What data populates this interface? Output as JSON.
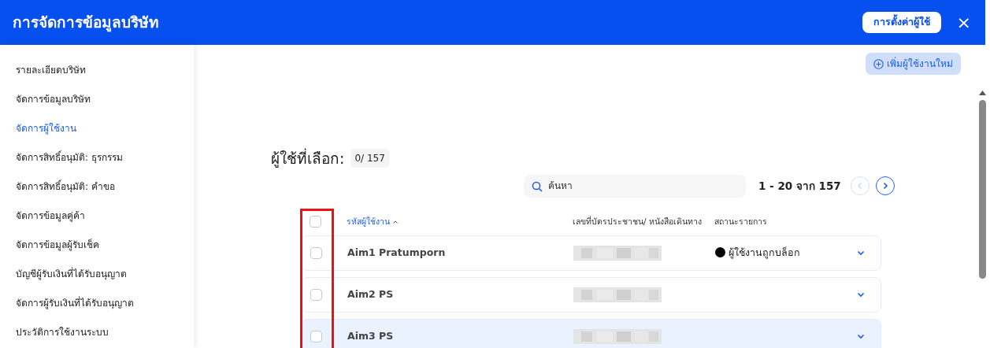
{
  "header": {
    "title": "การจัดการข้อมูลบริษัท",
    "settings_button": "การตั้งค่าผู้ใช้",
    "close": "×"
  },
  "sidebar": {
    "items": [
      {
        "label": "รายละเอียดบริษัท",
        "selected": false
      },
      {
        "label": "จัดการข้อมูลบริษัท",
        "selected": false
      },
      {
        "label": "จัดการผู้ใช้งาน",
        "selected": true
      },
      {
        "label": "จัดการสิทธิ์อนุมัติ: ธุรกรรม",
        "selected": false
      },
      {
        "label": "จัดการสิทธิ์อนุมัติ: คำขอ",
        "selected": false
      },
      {
        "label": "จัดการข้อมูลคู่ค้า",
        "selected": false
      },
      {
        "label": "จัดการข้อมูลผู้รับเช็ค",
        "selected": false
      },
      {
        "label": "บัญชีผู้รับเงินที่ได้รับอนุญาต",
        "selected": false
      },
      {
        "label": "จัดการผู้รับเงินที่ได้รับอนุญาต",
        "selected": false
      },
      {
        "label": "ประวัติการใช้งานระบบ",
        "selected": false
      }
    ]
  },
  "add_button": "เพิ่มผู้ใช้งานใหม่",
  "selection": {
    "label": "ผู้ใช้ที่เลือก:",
    "count": "0/ 157"
  },
  "search": {
    "placeholder": "ค้นหา"
  },
  "pagination": {
    "range": "1 - 20 จาก 157",
    "prev_disabled": true,
    "next_disabled": false
  },
  "table": {
    "select_all_checked": false,
    "columns": [
      {
        "label": "รหัสผู้ใช้งาน",
        "sorted": true
      },
      {
        "label": "เลขที่บัตรประชาชน/ หนังสือเดินทาง"
      },
      {
        "label": "สถานะรายการ"
      }
    ],
    "rows": [
      {
        "name": "Aim1 Pratumporn",
        "checked": false,
        "highlighted": false,
        "status": "ผู้ใช้งานถูกบล็อก",
        "color": "#000000"
      },
      {
        "name": "Aim2 PS",
        "checked": false,
        "highlighted": false
      },
      {
        "name": "Aim3 PS",
        "checked": false,
        "highlighted": true
      }
    ]
  }
}
